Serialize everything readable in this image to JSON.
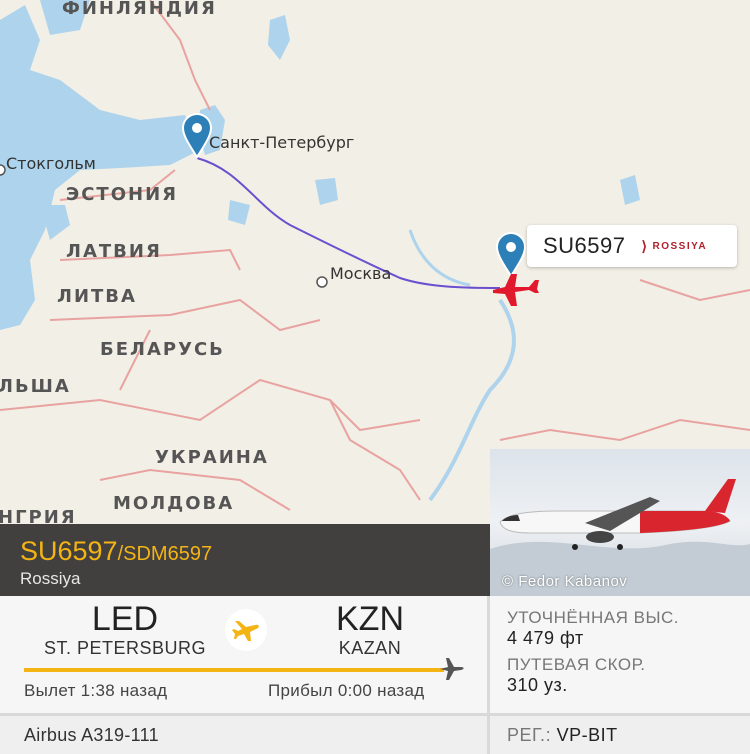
{
  "map": {
    "countries": {
      "finland": "ФИНЛЯНДИЯ",
      "estonia": "ЭСТОНИЯ",
      "latvia": "ЛАТВИЯ",
      "lithuania": "ЛИТВА",
      "belarus": "БЕЛАРУСЬ",
      "poland": "ЛЬША",
      "ukraine": "УКРАИНА",
      "moldova": "МОЛДОВА",
      "hungary": "НГРИЯ"
    },
    "cities": {
      "spb": "Санкт-Петербург",
      "stockholm": "Стокгольм",
      "moscow": "Москва"
    },
    "colors": {
      "water": "#aed3ec",
      "land": "#f2efe6",
      "border": "#e8a3a0",
      "route": "#6b4fcf",
      "plane": "#e2192c",
      "pin": "#2d7fb8"
    }
  },
  "callout": {
    "flight_number": "SU6597",
    "airline_logo_text": "ROSSIYA"
  },
  "photo": {
    "credit": "© Fedor Kabanov"
  },
  "flight": {
    "code": "SU6597",
    "alt_code": "/SDM6597",
    "airline": "Rossiya"
  },
  "route": {
    "origin": {
      "iata": "LED",
      "city": "ST. PETERSBURG"
    },
    "destination": {
      "iata": "KZN",
      "city": "KAZAN"
    },
    "departed": "Вылет 1:38 назад",
    "arrived": "Прибыл 0:00 назад",
    "progress": 1.0
  },
  "stats": {
    "altitude_label": "УТОЧНЁННАЯ ВЫС.",
    "altitude_value": "4 479 фт",
    "speed_label": "ПУТЕВАЯ СКОР.",
    "speed_value": "310 уз."
  },
  "aircraft": {
    "type": "Airbus A319-111",
    "reg_label": "РЕГ.:",
    "reg_value": "VP-BIT"
  }
}
